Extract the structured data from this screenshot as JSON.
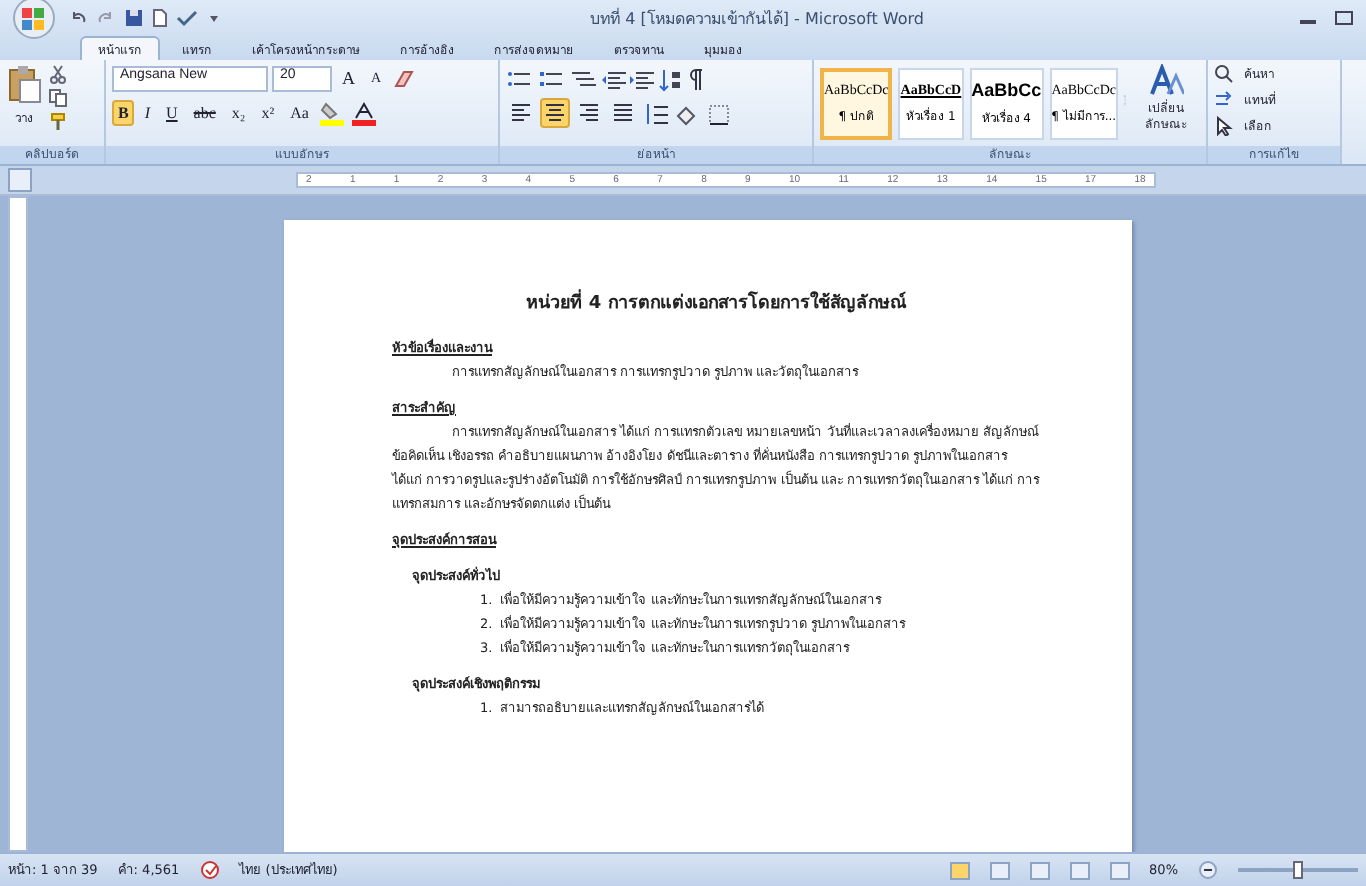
{
  "window": {
    "title": "บทที่ 4 [โหมดความเข้ากันได้] - Microsoft Word"
  },
  "tabs": [
    {
      "label": "หน้าแรก",
      "selected": true
    },
    {
      "label": "แทรก",
      "selected": false
    },
    {
      "label": "เค้าโครงหน้ากระดาษ",
      "selected": false
    },
    {
      "label": "การอ้างอิง",
      "selected": false
    },
    {
      "label": "การส่งจดหมาย",
      "selected": false
    },
    {
      "label": "ตรวจทาน",
      "selected": false
    },
    {
      "label": "มุมมอง",
      "selected": false
    }
  ],
  "ribbon": {
    "clipboard": {
      "paste_label": "วาง",
      "group_label": "คลิปบอร์ด"
    },
    "font": {
      "name": "Angsana New",
      "size": "20",
      "grow": "A",
      "shrink": "A",
      "buttons": [
        {
          "label": "B",
          "selected": true
        },
        {
          "label": "I",
          "selected": false
        },
        {
          "label": "U",
          "selected": false
        },
        {
          "label": "abc",
          "selected": false
        },
        {
          "label": "x₂",
          "selected": false
        },
        {
          "label": "x²",
          "selected": false
        },
        {
          "label": "Aa",
          "selected": false
        }
      ],
      "group_label": "แบบอักษร"
    },
    "paragraph": {
      "alignments": [
        {
          "selected": false
        },
        {
          "selected": true
        },
        {
          "selected": false
        },
        {
          "selected": false
        }
      ],
      "group_label": "ย่อหน้า"
    },
    "styles": {
      "items": [
        {
          "sample": "AaBbCcDc",
          "label": "¶ ปกติ",
          "selected": true
        },
        {
          "sample": "AaBbCcD",
          "label": "หัวเรื่อง 1",
          "selected": false
        },
        {
          "sample": "AaBbCc",
          "label": "หัวเรื่อง 4",
          "selected": false
        },
        {
          "sample": "AaBbCcDc",
          "label": "¶ ไม่มีการ...",
          "selected": false
        }
      ],
      "change_label": "เปลี่ยนลักษณะ",
      "group_label": "ลักษณะ"
    },
    "editing": {
      "items": [
        "ค้นหา",
        "แทนที่",
        "เลือก"
      ],
      "group_label": "การแก้ไข"
    }
  },
  "ruler": {
    "numbers": [
      "2",
      "1",
      "1",
      "2",
      "3",
      "4",
      "5",
      "6",
      "7",
      "8",
      "9",
      "10",
      "11",
      "12",
      "13",
      "14",
      "15",
      "17",
      "18"
    ]
  },
  "document": {
    "heading": "หน่วยที่ 4 การตกแต่งเอกสารโดยการใช้สัญลักษณ์",
    "sections": [
      {
        "kind": "topic",
        "title": "หัวข้อเรื่องและงาน",
        "text": "การแทรกสัญลักษณ์ในเอกสาร การแทรกรูปวาด รูปภาพ และวัตถุในเอกสาร"
      },
      {
        "kind": "topic",
        "title": "สาระสำคัญ",
        "text": "การแทรกสัญลักษณ์ในเอกสาร ได้แก่ การแทรกตัวเลข หมายเลขหน้า วันที่และเวลาลงเครื่องหมาย สัญลักษณ์ ข้อคิดเห็น เชิงอรรถ คำอธิบายแผนภาพ อ้างอิงโยง ดัชนีและตาราง ที่คั่นหนังสือ การแทรกรูปวาด รูปภาพในเอกสาร ได้แก่ การวาดรูปและรูปร่างอัตโนมัติ การใช้อักษรศิลป์ การแทรกรูปภาพ เป็นต้น และ การแทรกวัตถุในเอกสาร ได้แก่ การแทรกสมการ และอักษรจัดตกแต่ง เป็นต้น"
      },
      {
        "kind": "topic",
        "title": "จุดประสงค์การสอน"
      },
      {
        "kind": "objectives",
        "title": "จุดประสงค์ทั่วไป",
        "items": [
          {
            "number": "1.",
            "text": "เพื่อให้มีความรู้ความเข้าใจ และทักษะในการแทรกสัญลักษณ์ในเอกสาร"
          },
          {
            "number": "2.",
            "text": "เพื่อให้มีความรู้ความเข้าใจ และทักษะในการแทรกรูปวาด รูปภาพในเอกสาร"
          },
          {
            "number": "3.",
            "text": "เพื่อให้มีความรู้ความเข้าใจ และทักษะในการแทรกวัตถุในเอกสาร"
          }
        ]
      },
      {
        "kind": "objectives",
        "title": "จุดประสงค์เชิงพฤติกรรม",
        "items": [
          {
            "number": "1.",
            "text": "สามารถอธิบายและแทรกสัญลักษณ์ในเอกสารได้"
          }
        ]
      }
    ]
  },
  "status_bar": {
    "page": "หน้า: 1 จาก 39",
    "words": "คำ: 4,561",
    "language": "ไทย (ประเทศไทย)",
    "zoom": "80%"
  }
}
